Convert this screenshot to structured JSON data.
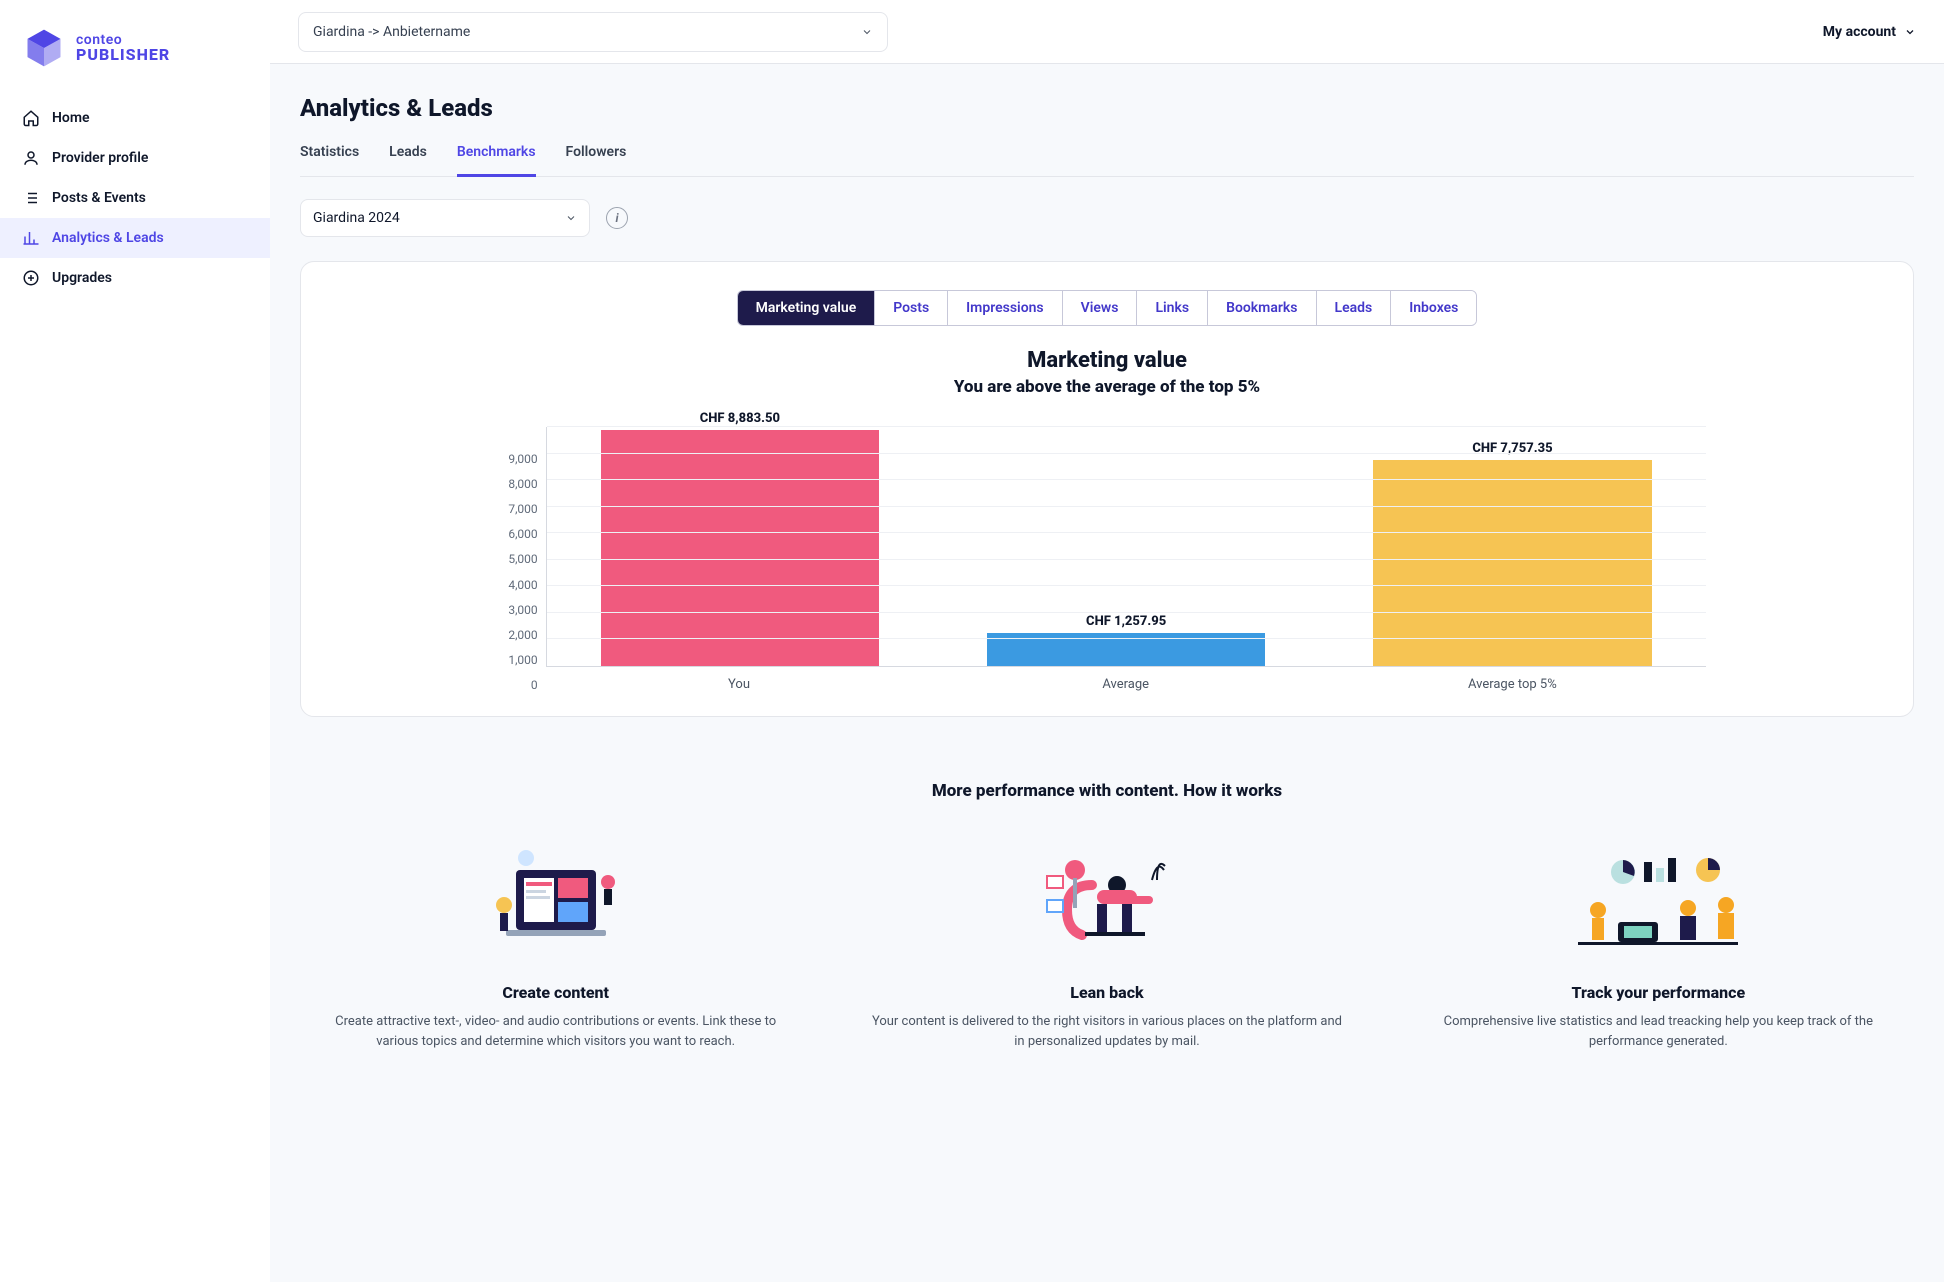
{
  "brand": {
    "line1": "conteo",
    "line2": "PUBLISHER"
  },
  "sidebar": {
    "active_index": 3,
    "items": [
      {
        "label": "Home",
        "icon": "home-icon"
      },
      {
        "label": "Provider profile",
        "icon": "user-icon"
      },
      {
        "label": "Posts & Events",
        "icon": "list-icon"
      },
      {
        "label": "Analytics & Leads",
        "icon": "chart-icon"
      },
      {
        "label": "Upgrades",
        "icon": "plus-circle-icon"
      }
    ]
  },
  "header": {
    "workspace_label": "Giardina -> Anbietername",
    "account_label": "My account"
  },
  "page": {
    "title": "Analytics & Leads",
    "tabs": [
      "Statistics",
      "Leads",
      "Benchmarks",
      "Followers"
    ],
    "active_tab_index": 2,
    "period_selected": "Giardina 2024"
  },
  "benchmark_segments": [
    "Marketing value",
    "Posts",
    "Impressions",
    "Views",
    "Links",
    "Bookmarks",
    "Leads",
    "Inboxes"
  ],
  "benchmark_active_index": 0,
  "chart_data": {
    "type": "bar",
    "title": "Marketing value",
    "subtitle": "You are above the average of the top 5%",
    "categories": [
      "You",
      "Average",
      "Average top 5%"
    ],
    "values": [
      8883.5,
      1257.95,
      7757.35
    ],
    "value_labels": [
      "CHF 8,883.50",
      "CHF 1,257.95",
      "CHF 7,757.35"
    ],
    "colors": [
      "#f05a7e",
      "#3b9ae1",
      "#f6c453"
    ],
    "y_ticks": [
      0,
      1000,
      2000,
      3000,
      4000,
      5000,
      6000,
      7000,
      8000,
      9000
    ],
    "y_tick_labels": [
      "0",
      "1,000",
      "2,000",
      "3,000",
      "4,000",
      "5,000",
      "6,000",
      "7,000",
      "8,000",
      "9,000"
    ],
    "ylim": [
      0,
      9000
    ],
    "xlabel": "",
    "ylabel": ""
  },
  "how_it_works": {
    "heading": "More performance with content. How it works",
    "cards": [
      {
        "title": "Create content",
        "body": "Create attractive text-, video- and audio contributions or events. Link these to various topics and determine which visitors you want to reach."
      },
      {
        "title": "Lean back",
        "body": "Your content is delivered to the right visitors in various places on the platform and in personalized updates by mail."
      },
      {
        "title": "Track your performance",
        "body": "Comprehensive live statistics and lead treacking help you keep track of the performance generated."
      }
    ]
  }
}
